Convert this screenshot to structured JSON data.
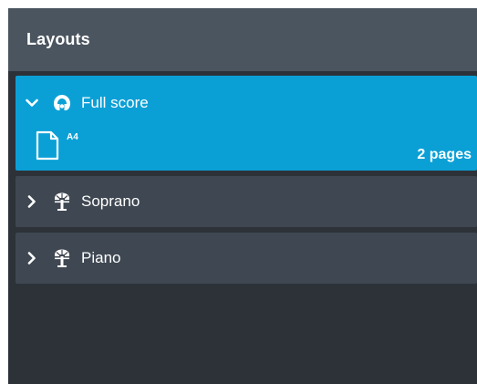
{
  "panel": {
    "title": "Layouts"
  },
  "layouts": [
    {
      "name": "Full score",
      "expanded": true,
      "selected": true,
      "icon": "full-score-icon",
      "page_size": "A4",
      "page_count": "2 pages"
    },
    {
      "name": "Soprano",
      "expanded": false,
      "selected": false,
      "icon": "part-layout-icon"
    },
    {
      "name": "Piano",
      "expanded": false,
      "selected": false,
      "icon": "part-layout-icon"
    }
  ],
  "colors": {
    "panel_bg": "#2d3239",
    "header_bg": "#4b555f",
    "row_bg": "#3f4852",
    "selected_bg": "#0aa0d6",
    "text": "#ffffff"
  }
}
